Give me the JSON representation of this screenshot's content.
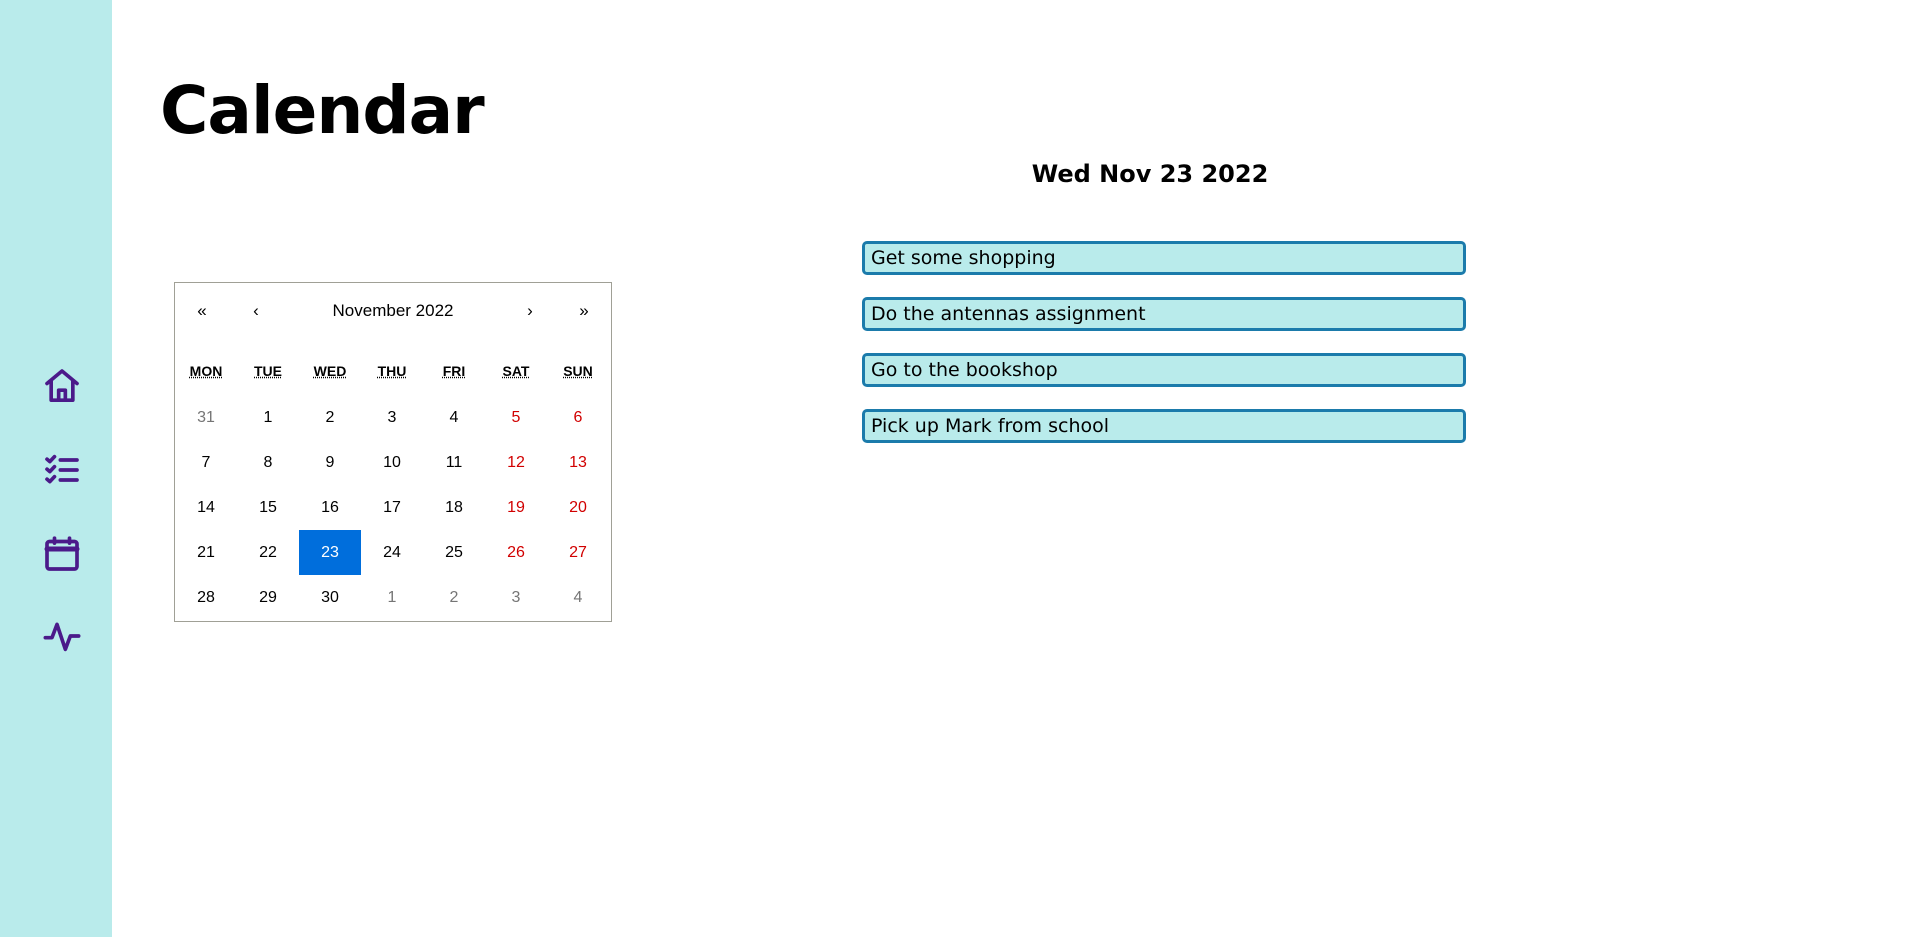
{
  "page": {
    "title": "Calendar"
  },
  "sidebar": {
    "items": [
      {
        "icon": "home-icon"
      },
      {
        "icon": "checklist-icon"
      },
      {
        "icon": "calendar-icon"
      },
      {
        "icon": "activity-icon"
      }
    ]
  },
  "calendar": {
    "nav": {
      "prev_year": "«",
      "prev_month": "‹",
      "label": "November 2022",
      "next_month": "›",
      "next_year": "»"
    },
    "weekdays": [
      "MON",
      "TUE",
      "WED",
      "THU",
      "FRI",
      "SAT",
      "SUN"
    ],
    "days": [
      "31",
      "1",
      "2",
      "3",
      "4",
      "5",
      "6",
      "7",
      "8",
      "9",
      "10",
      "11",
      "12",
      "13",
      "14",
      "15",
      "16",
      "17",
      "18",
      "19",
      "20",
      "21",
      "22",
      "23",
      "24",
      "25",
      "26",
      "27",
      "28",
      "29",
      "30",
      "1",
      "2",
      "3",
      "4"
    ],
    "selected_day": "23"
  },
  "selected_date": "Wed Nov 23 2022",
  "tasks": [
    "Get some shopping",
    "Do the antennas assignment",
    "Go to the bookshop",
    "Pick up Mark from school"
  ],
  "colors": {
    "sidebar_bg": "#b9ebeb",
    "icon": "#4b1a8a",
    "task_border": "#1b7bab",
    "active_day": "#006edc",
    "weekend": "#d10000",
    "neighbor_month": "#757575"
  }
}
